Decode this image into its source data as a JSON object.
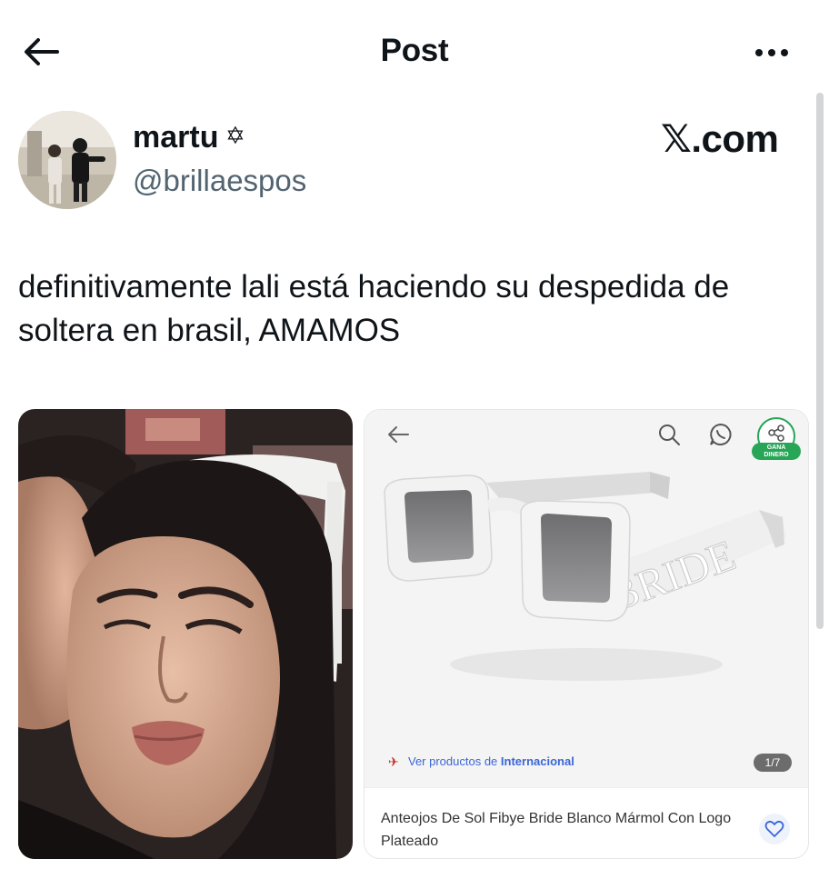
{
  "header": {
    "title": "Post",
    "back_icon": "arrow-left-icon",
    "more_icon": "more-horizontal-icon"
  },
  "author": {
    "name": "martu",
    "badge": "✡",
    "handle": "@brillaespos"
  },
  "source": {
    "label": "𝕏.com"
  },
  "post": {
    "text": "definitivamente lali está haciendo su despedida de soltera en brasil, AMAMOS"
  },
  "product_card": {
    "share_badge_line1": "GANA",
    "share_badge_line2": "DINERO",
    "lens_text": "BRIDE",
    "ver_prefix": "Ver productos de ",
    "ver_store": "Internacional",
    "page_indicator": "1/7",
    "title": "Anteojos De Sol Fibye Bride Blanco Mármol Con Logo Plateado"
  },
  "colors": {
    "text_primary": "#0f1419",
    "text_secondary": "#536471",
    "share_green": "#27a658",
    "link_blue": "#3b66d8"
  }
}
